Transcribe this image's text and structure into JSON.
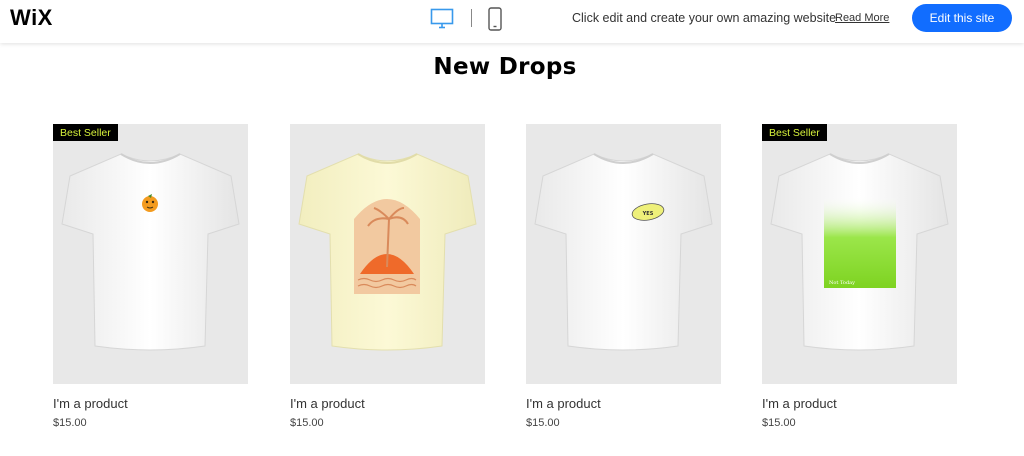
{
  "topbar": {
    "logo": "WiX",
    "promo_text": "Click edit and create your own amazing website",
    "read_more": "Read More",
    "edit_button": "Edit this site",
    "accent_color": "#116dff"
  },
  "section": {
    "title": "New Drops"
  },
  "products": [
    {
      "badge": "Best Seller",
      "name": "I'm a product",
      "price": "$15.00",
      "shirt_color": "#ffffff",
      "graphic": "orange-fruit-logo"
    },
    {
      "badge": "",
      "name": "I'm a product",
      "price": "$15.00",
      "shirt_color": "#fbf7cf",
      "graphic": "palm-sunset-arch"
    },
    {
      "badge": "",
      "name": "I'm a product",
      "price": "$15.00",
      "shirt_color": "#ffffff",
      "graphic": "yellow-oval-patch",
      "graphic_text": "YES"
    },
    {
      "badge": "Best Seller",
      "name": "I'm a product",
      "price": "$15.00",
      "shirt_color": "#ffffff",
      "graphic": "green-gradient-print",
      "graphic_text": "Not Today"
    }
  ]
}
